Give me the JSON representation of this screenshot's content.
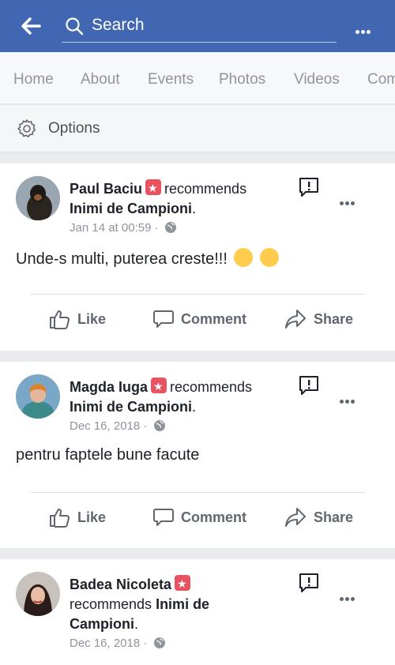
{
  "search": {
    "placeholder": "Search"
  },
  "tabs": [
    "Home",
    "About",
    "Events",
    "Photos",
    "Videos",
    "Com"
  ],
  "options": {
    "label": "Options"
  },
  "posts": [
    {
      "author": "Paul Baciu",
      "action": "recommends",
      "page": "Inimi de Campioni",
      "period": ".",
      "date": "Jan 14 at 00:59 ·",
      "text": "Unde-s multi, puterea creste!!!",
      "emojis": [
        "hugging-face-emoji",
        "heart-eyes-emoji"
      ]
    },
    {
      "author": "Magda Iuga",
      "action": "recommends",
      "page": "Inimi de Campioni",
      "period": ".",
      "date": "Dec 16, 2018 ·",
      "text": "pentru faptele bune facute"
    },
    {
      "author": "Badea Nicoleta",
      "action": "recommends",
      "page_part1": "Inimi de",
      "page_part2": "Campioni",
      "period": ".",
      "date": "Dec 16, 2018 ·"
    }
  ],
  "actions": {
    "like": "Like",
    "comment": "Comment",
    "share": "Share"
  },
  "colors": {
    "brand": "#4267b2",
    "badge": "#e9525f",
    "text": "#1d2129",
    "muted": "#90949c"
  },
  "icons": [
    "back-arrow-icon",
    "search-icon",
    "more-icon",
    "gear-icon",
    "recommend-badge-icon",
    "globe-icon",
    "report-icon",
    "like-icon",
    "comment-icon",
    "share-icon"
  ]
}
